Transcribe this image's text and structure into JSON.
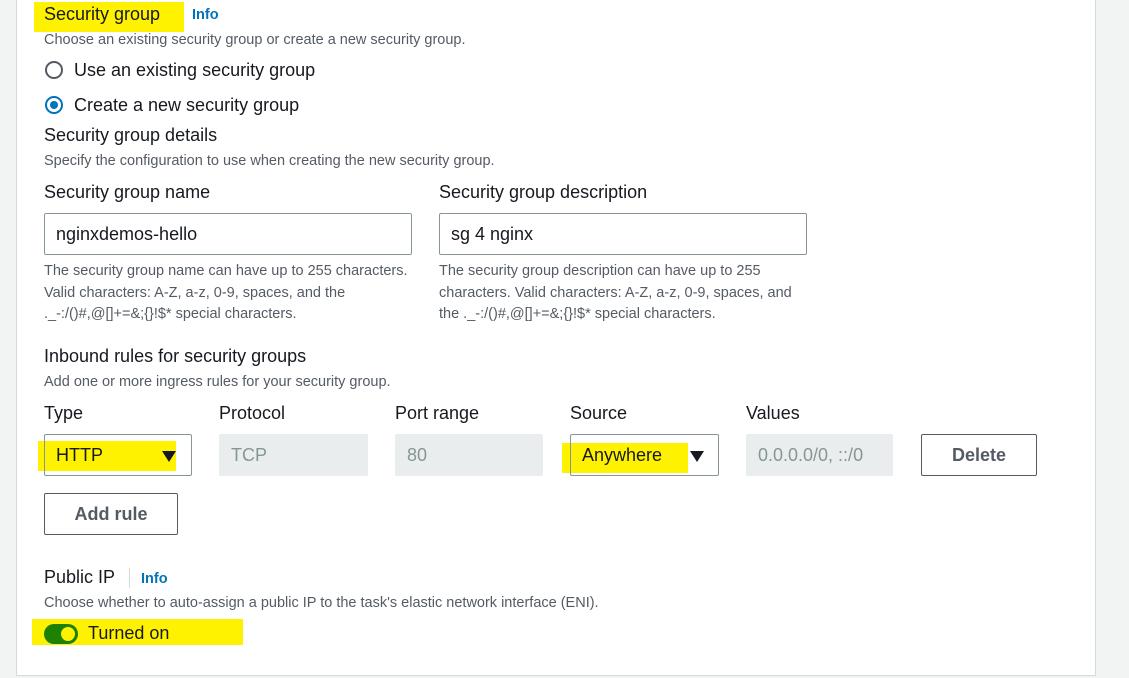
{
  "security_group": {
    "title": "Security group",
    "info": "Info",
    "description": "Choose an existing security group or create a new security group.",
    "options": [
      {
        "label": "Use an existing security group",
        "selected": false
      },
      {
        "label": "Create a new security group",
        "selected": true
      }
    ]
  },
  "details": {
    "title": "Security group details",
    "description": "Specify the configuration to use when creating the new security group.",
    "name_label": "Security group name",
    "name_value": "nginxdemos-hello",
    "name_help": "The security group name can have up to 255 characters. Valid characters: A-Z, a-z, 0-9, spaces, and the ._-:/()#,@[]+=&;{}!$* special characters.",
    "desc_label": "Security group description",
    "desc_value": "sg 4 nginx",
    "desc_help": "The security group description can have up to 255 characters. Valid characters: A-Z, a-z, 0-9, spaces, and the ._-:/()#,@[]+=&;{}!$* special characters."
  },
  "inbound": {
    "title": "Inbound rules for security groups",
    "description": "Add one or more ingress rules for your security group.",
    "columns": [
      "Type",
      "Protocol",
      "Port range",
      "Source",
      "Values"
    ],
    "rule": {
      "type": "HTTP",
      "protocol": "TCP",
      "port_range": "80",
      "source": "Anywhere",
      "values": "0.0.0.0/0, ::/0"
    },
    "delete_label": "Delete",
    "add_rule_label": "Add rule"
  },
  "public_ip": {
    "title": "Public IP",
    "info": "Info",
    "description": "Choose whether to auto-assign a public IP to the task's elastic network interface (ENI).",
    "toggle_label": "Turned on",
    "enabled": true
  },
  "colors": {
    "highlight": "#fff200",
    "link": "#0073bb",
    "toggle_on": "#1d8102"
  }
}
